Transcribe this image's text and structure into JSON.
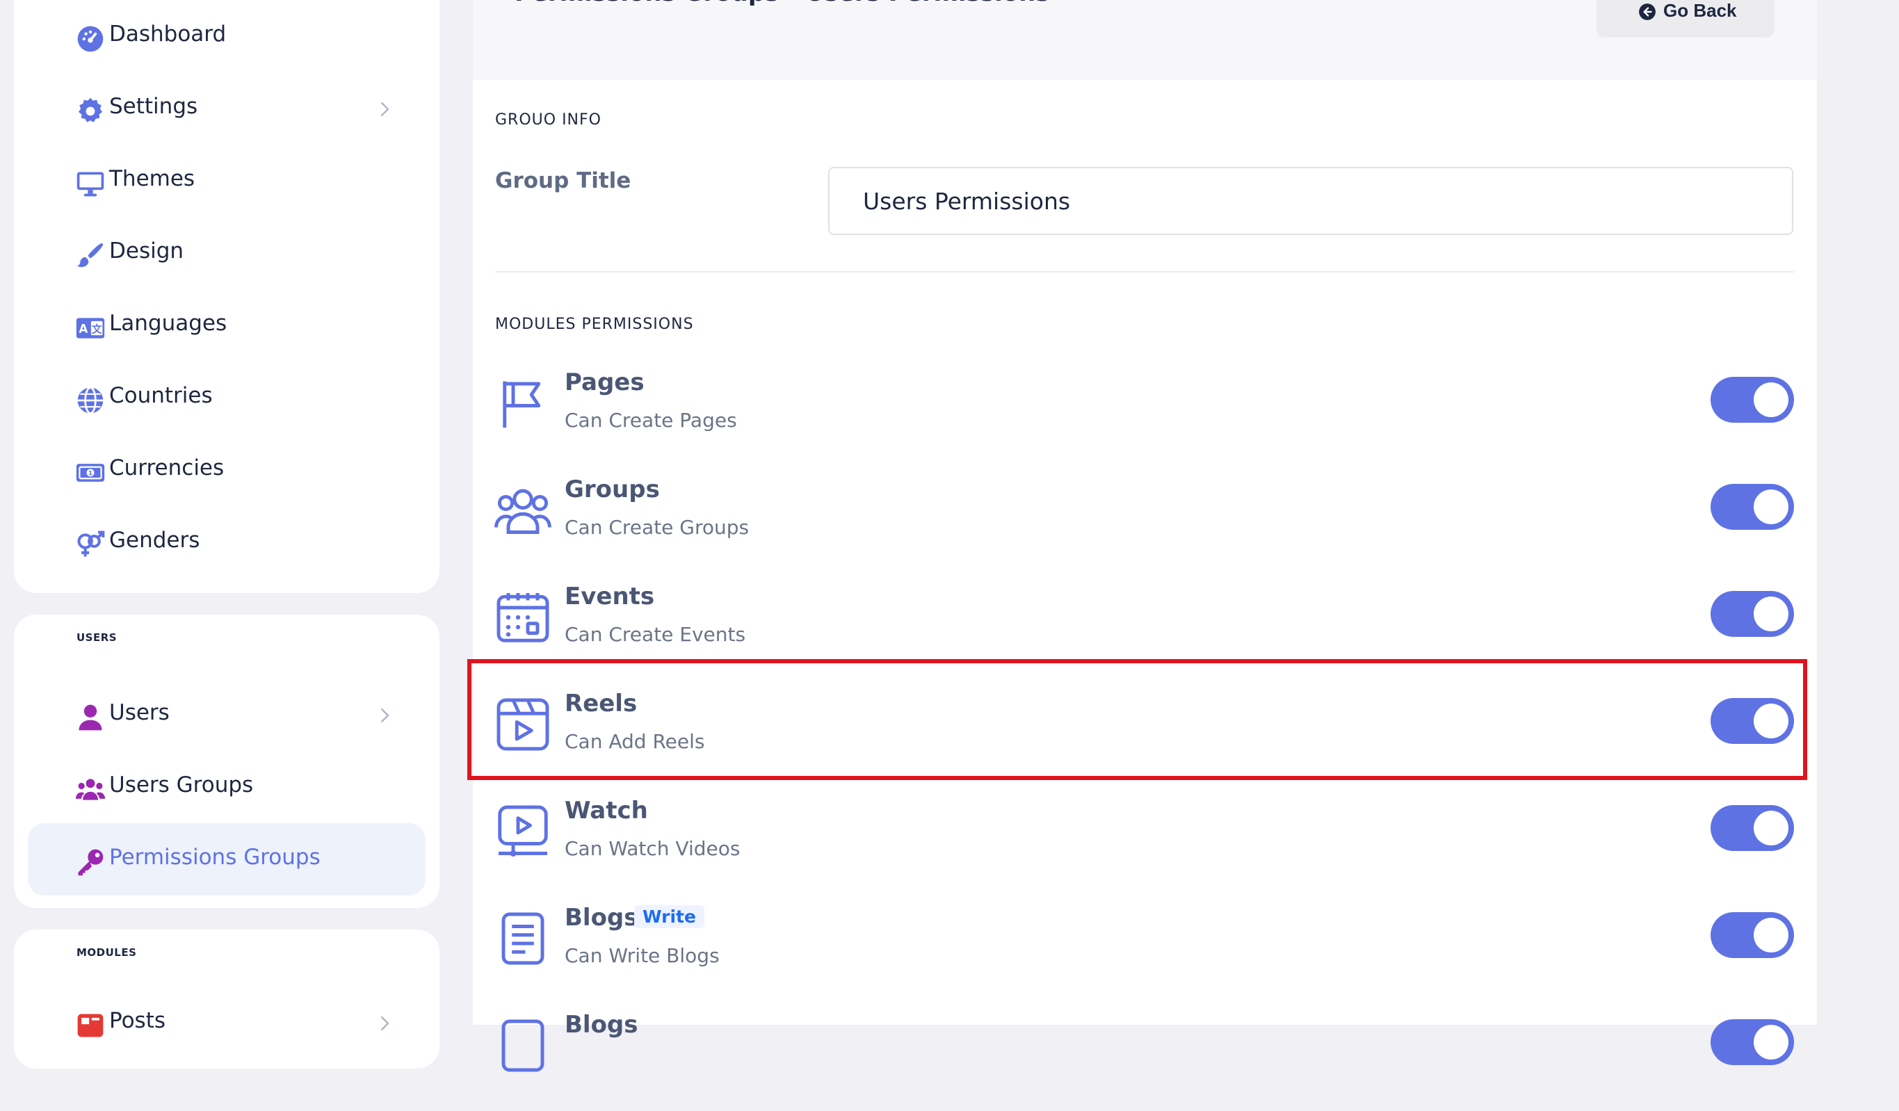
{
  "sidebar": {
    "items": [
      {
        "label": "Dashboard",
        "icon": "dashboard-gauge-icon",
        "has_chevron": false
      },
      {
        "label": "Settings",
        "icon": "gear-icon",
        "has_chevron": true
      },
      {
        "label": "Themes",
        "icon": "monitor-icon",
        "has_chevron": false
      },
      {
        "label": "Design",
        "icon": "paintbrush-icon",
        "has_chevron": false
      },
      {
        "label": "Languages",
        "icon": "language-icon",
        "has_chevron": false
      },
      {
        "label": "Countries",
        "icon": "globe-icon",
        "has_chevron": false
      },
      {
        "label": "Currencies",
        "icon": "money-bill-icon",
        "has_chevron": false
      },
      {
        "label": "Genders",
        "icon": "gender-icon",
        "has_chevron": false
      }
    ],
    "users_section": {
      "label": "USERS",
      "items": [
        {
          "label": "Users",
          "icon": "user-icon",
          "has_chevron": true
        },
        {
          "label": "Users Groups",
          "icon": "users-group-icon",
          "has_chevron": false
        },
        {
          "label": "Permissions Groups",
          "icon": "key-icon",
          "has_chevron": false,
          "active": true
        }
      ]
    },
    "modules_section": {
      "label": "MODULES",
      "items": [
        {
          "label": "Posts",
          "icon": "posts-icon",
          "has_chevron": true
        }
      ]
    }
  },
  "header": {
    "title": "Permissions Groups › Users Permissions",
    "go_back_label": "Go Back"
  },
  "group_info": {
    "section_label": "GROUO INFO",
    "group_title_label": "Group Title",
    "group_title_value": "Users Permissions"
  },
  "modules_permissions": {
    "section_label": "MODULES PERMISSIONS",
    "rows": [
      {
        "title": "Pages",
        "description": "Can Create Pages",
        "icon": "flag-icon",
        "enabled": true
      },
      {
        "title": "Groups",
        "description": "Can Create Groups",
        "icon": "users-icon",
        "enabled": true
      },
      {
        "title": "Events",
        "description": "Can Create Events",
        "icon": "calendar-icon",
        "enabled": true
      },
      {
        "title": "Reels",
        "description": "Can Add Reels",
        "icon": "reels-icon",
        "enabled": true,
        "highlighted": true
      },
      {
        "title": "Watch",
        "description": "Can Watch Videos",
        "icon": "video-monitor-icon",
        "enabled": true
      },
      {
        "title": "Blogs",
        "badge": "Write",
        "description": "Can Write Blogs",
        "icon": "document-icon",
        "enabled": true
      },
      {
        "title": "Blogs",
        "description": "",
        "icon": "document-icon",
        "enabled": true
      }
    ]
  },
  "colors": {
    "accent": "#5e72e4",
    "sidebar_icon": "#5e72e4",
    "users_icon": "#9c27b0",
    "highlight_border": "#e0141e",
    "background": "#f0f0f5"
  }
}
